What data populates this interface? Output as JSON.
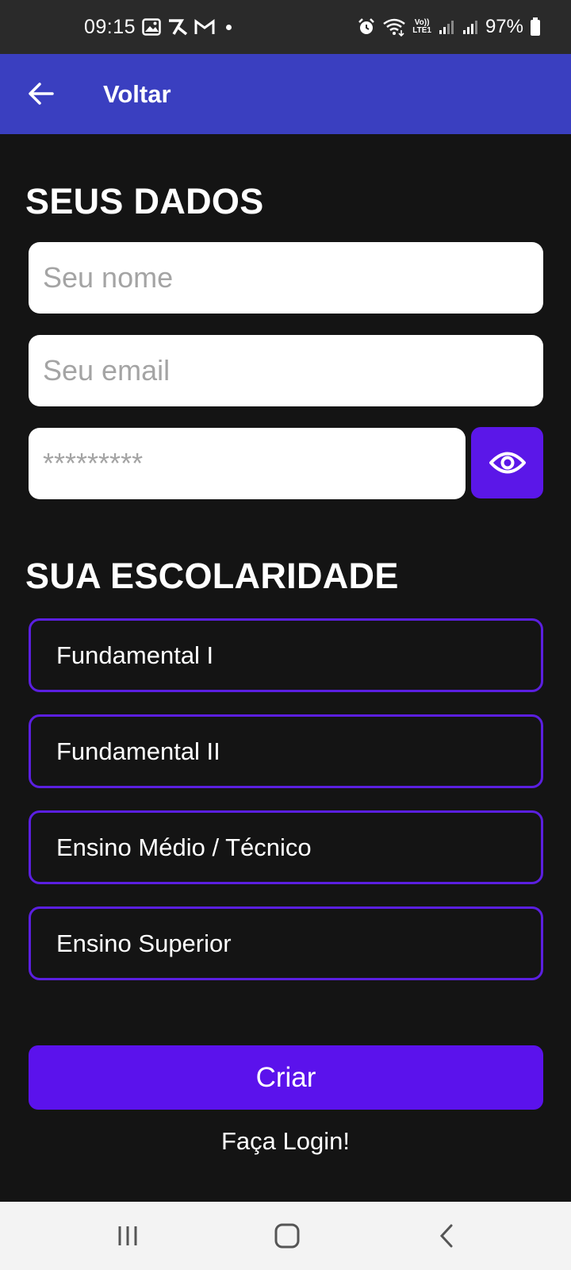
{
  "status_bar": {
    "time": "09:15",
    "battery": "97%",
    "lte_top": "Vo))",
    "lte_bottom": "LTE1",
    "icons": [
      "image-icon",
      "app-icon",
      "gmail-icon",
      "notification-dot",
      "alarm-icon",
      "wifi-icon",
      "volte-icon",
      "signal-icon",
      "signal-icon",
      "battery-icon"
    ]
  },
  "app_bar": {
    "title": "Voltar",
    "color": "#3a3fc0"
  },
  "personal": {
    "heading": "SEUS DADOS",
    "name_placeholder": "Seu nome",
    "email_placeholder": "Seu email",
    "password_placeholder": "*********"
  },
  "education": {
    "heading": "SUA ESCOLARIDADE",
    "options": [
      "Fundamental I",
      "Fundamental II",
      "Ensino Médio / Técnico",
      "Ensino Superior"
    ]
  },
  "actions": {
    "create_label": "Criar",
    "login_label": "Faça Login!"
  },
  "colors": {
    "background": "#141414",
    "accent": "#5b12ec",
    "option_border": "#5b1fe0"
  }
}
